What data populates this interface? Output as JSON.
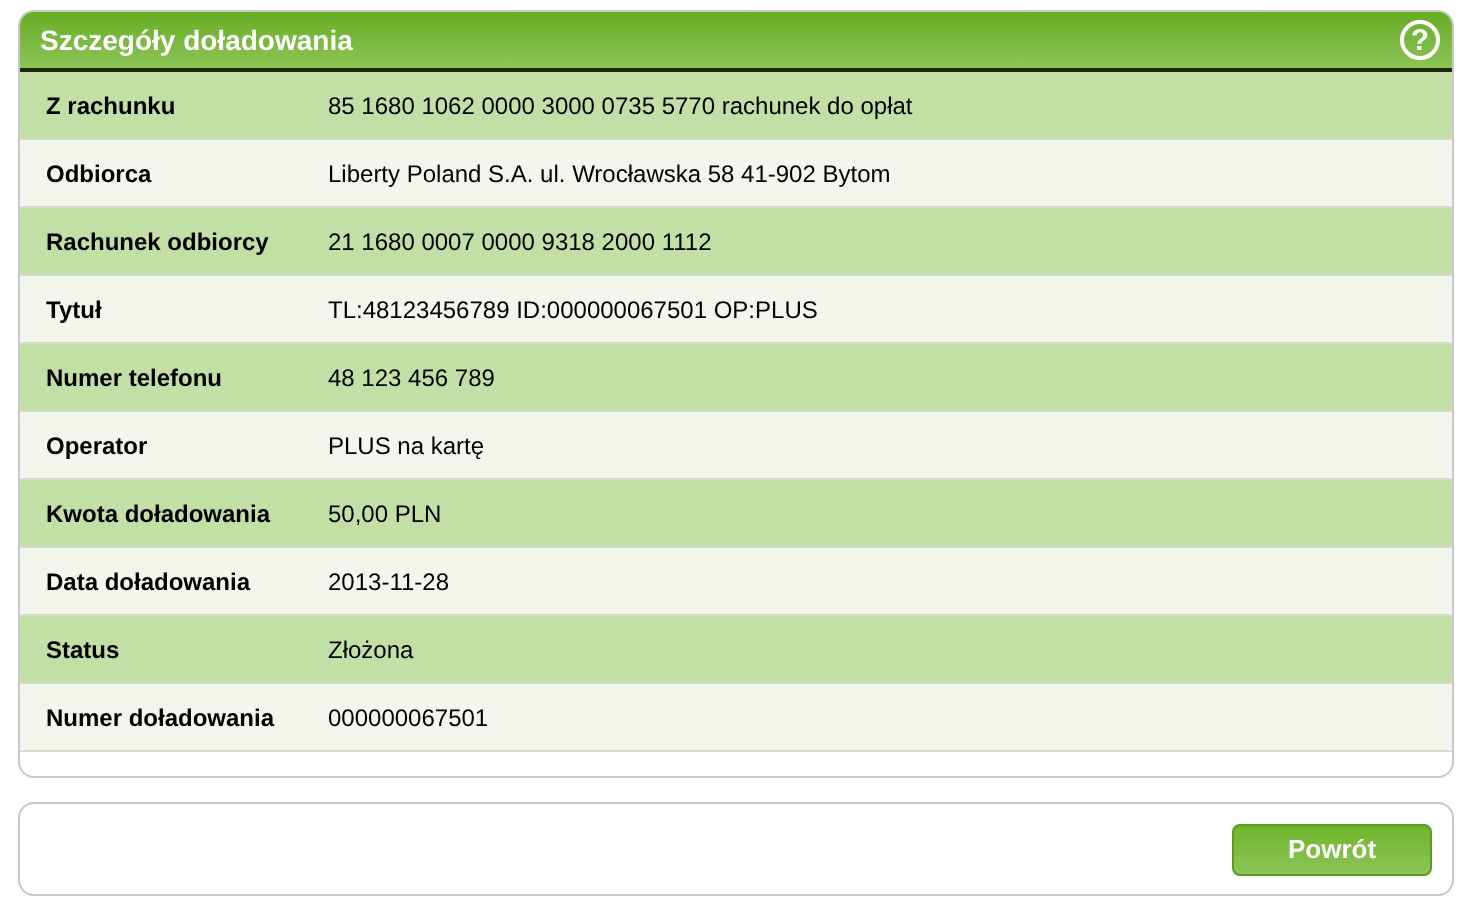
{
  "panel": {
    "title": "Szczegóły doładowania",
    "help": "?"
  },
  "rows": [
    {
      "label": "Z rachunku",
      "value": "85 1680 1062 0000 3000 0735 5770 rachunek do opłat"
    },
    {
      "label": "Odbiorca",
      "value": "Liberty Poland S.A. ul. Wrocławska 58 41-902 Bytom"
    },
    {
      "label": "Rachunek odbiorcy",
      "value": "21 1680 0007 0000 9318 2000 1112"
    },
    {
      "label": "Tytuł",
      "value": "TL:48123456789 ID:000000067501 OP:PLUS"
    },
    {
      "label": "Numer telefonu",
      "value": "48 123 456 789"
    },
    {
      "label": "Operator",
      "value": "PLUS na kartę"
    },
    {
      "label": "Kwota doładowania",
      "value": "50,00 PLN"
    },
    {
      "label": "Data doładowania",
      "value": "2013-11-28"
    },
    {
      "label": "Status",
      "value": "Złożona"
    },
    {
      "label": "Numer doładowania",
      "value": "000000067501"
    }
  ],
  "buttons": [
    "Powrót"
  ]
}
